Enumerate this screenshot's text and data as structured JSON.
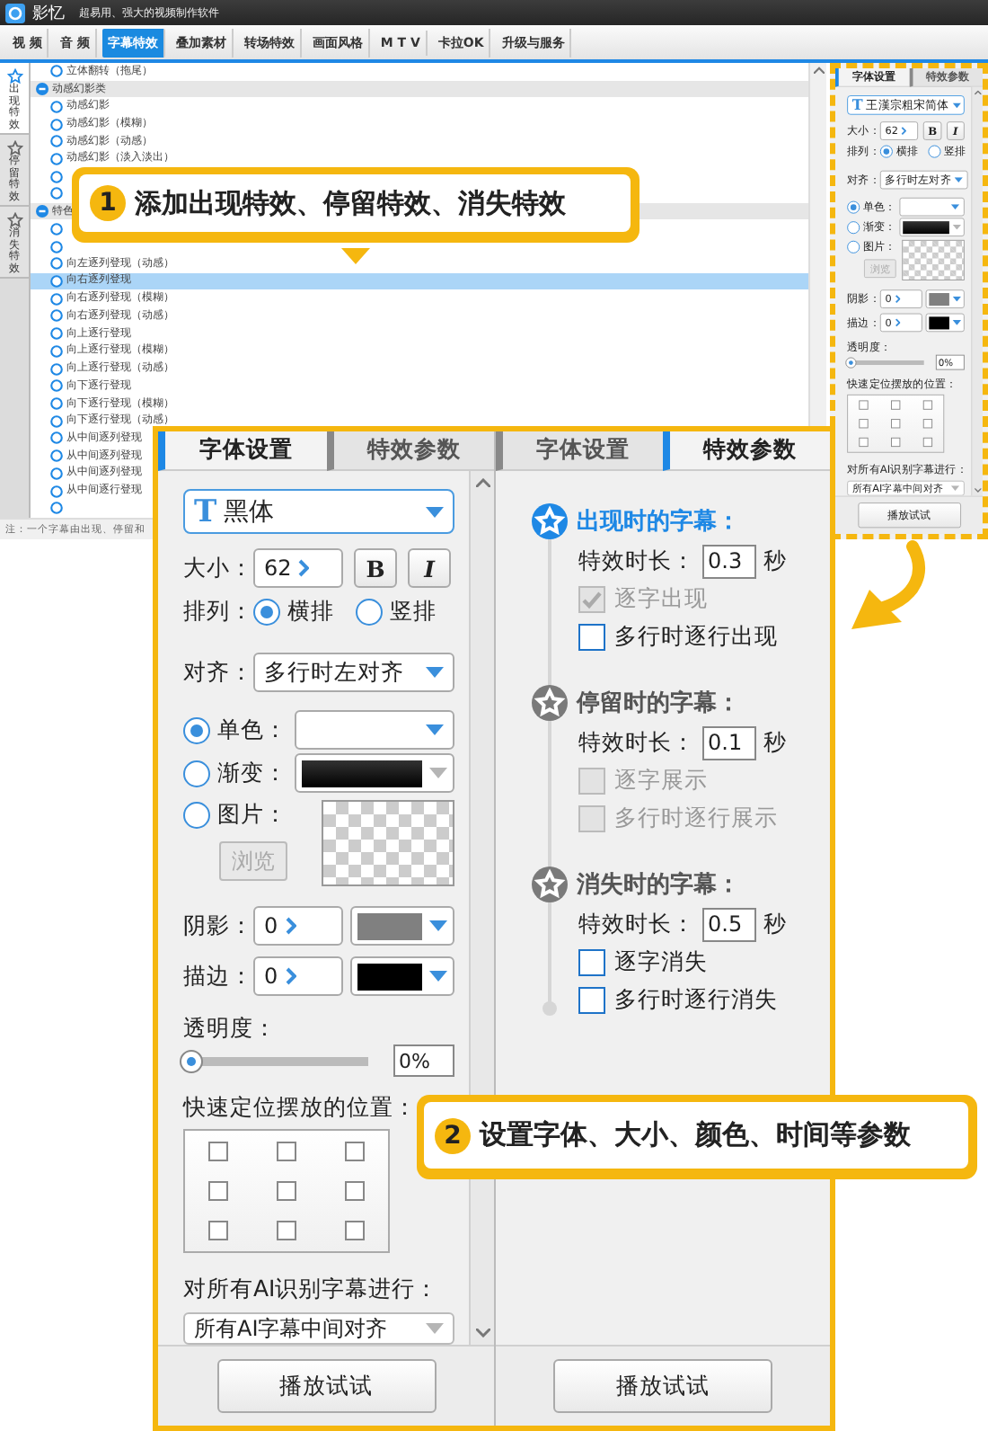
{
  "app": {
    "name": "影忆",
    "tagline": "超易用、强大的视频制作软件"
  },
  "menu": [
    {
      "label": "视 频",
      "selected": false
    },
    {
      "label": "音 频",
      "selected": false
    },
    {
      "label": "字幕特效",
      "selected": true
    },
    {
      "label": "叠加素材",
      "selected": false
    },
    {
      "label": "转场特效",
      "selected": false
    },
    {
      "label": "画面风格",
      "selected": false
    },
    {
      "label": "M T V",
      "selected": false
    },
    {
      "label": "卡拉OK",
      "selected": false
    },
    {
      "label": "升级与服务",
      "selected": false
    }
  ],
  "side_tabs": [
    {
      "label": "出现特效",
      "selected": true
    },
    {
      "label": "停留特效",
      "selected": false
    },
    {
      "label": "消失特效",
      "selected": false
    }
  ],
  "effects_list": [
    {
      "kind": "item",
      "label": "立体翻转（拖尾）",
      "selected": false
    },
    {
      "kind": "group",
      "label": "动感幻影类",
      "expanded": true
    },
    {
      "kind": "item",
      "label": "动感幻影",
      "selected": false
    },
    {
      "kind": "item",
      "label": "动感幻影（模糊）",
      "selected": false
    },
    {
      "kind": "item",
      "label": "动感幻影（动感）",
      "selected": false
    },
    {
      "kind": "item",
      "label": "动感幻影（淡入淡出）",
      "selected": false
    },
    {
      "kind": "item",
      "selected": false
    },
    {
      "kind": "item",
      "selected": false
    },
    {
      "kind": "group",
      "label": "特色",
      "expanded": true
    },
    {
      "kind": "item",
      "selected": false
    },
    {
      "kind": "item",
      "selected": false
    },
    {
      "kind": "item",
      "label": "向左逐列登现（动感）",
      "selected": false
    },
    {
      "kind": "item",
      "label": "向右逐列登现",
      "selected": true
    },
    {
      "kind": "item",
      "label": "向右逐列登现（模糊）",
      "selected": false
    },
    {
      "kind": "item",
      "label": "向右逐列登现（动感）",
      "selected": false
    },
    {
      "kind": "item",
      "label": "向上逐行登现",
      "selected": false
    },
    {
      "kind": "item",
      "label": "向上逐行登现（模糊）",
      "selected": false
    },
    {
      "kind": "item",
      "label": "向上逐行登现（动感）",
      "selected": false
    },
    {
      "kind": "item",
      "label": "向下逐行登现",
      "selected": false
    },
    {
      "kind": "item",
      "label": "向下逐行登现（模糊）",
      "selected": false
    },
    {
      "kind": "item",
      "label": "向下逐行登现（动感）",
      "selected": false
    },
    {
      "kind": "item",
      "label": "从中间逐列登现",
      "selected": false
    },
    {
      "kind": "item",
      "label": "从中间逐列登现",
      "selected": false
    },
    {
      "kind": "item",
      "label": "从中间逐列登现",
      "selected": false
    },
    {
      "kind": "item",
      "label": "从中间逐行登现",
      "selected": false
    },
    {
      "kind": "item",
      "selected": false
    }
  ],
  "note": "注：一个字幕由出现、停留和",
  "mini_panel": {
    "tabs": [
      {
        "label": "字体设置",
        "selected": true
      },
      {
        "label": "特效参数",
        "selected": false
      }
    ],
    "font_icon": "T",
    "font": "王漢宗粗宋简体",
    "size_label": "大小：",
    "size": "62",
    "bold_button": "B",
    "italic_button": "I",
    "layout_label": "排列：",
    "layout": [
      {
        "label": "横排",
        "selected": true
      },
      {
        "label": "竖排",
        "selected": false
      }
    ],
    "align_label": "对齐：",
    "align": "多行时左对齐",
    "fill": [
      {
        "kind": "solid",
        "label": "单色：",
        "selected": true
      },
      {
        "kind": "gradient",
        "label": "渐变：",
        "selected": false
      },
      {
        "kind": "image",
        "label": "图片：",
        "selected": false
      }
    ],
    "browse_button": {
      "label": "浏览",
      "disabled": true
    },
    "outline": [
      {
        "label": "阴影：",
        "value": "0",
        "color": "#808080"
      },
      {
        "label": "描边：",
        "value": "0",
        "color": "#000000"
      }
    ],
    "opacity_label": "透明度：",
    "opacity": {
      "level": 0,
      "reading": "0%"
    },
    "position_label": "快速定位摆放的位置：",
    "positions": [
      {
        "checked": false
      },
      {
        "checked": false
      },
      {
        "checked": false
      },
      {
        "checked": false
      },
      {
        "checked": false
      },
      {
        "checked": false
      },
      {
        "checked": false
      },
      {
        "checked": false
      },
      {
        "checked": false
      }
    ],
    "ai_label": "对所有AI识别字幕进行：",
    "ai_option": "所有AI字幕中间对齐",
    "play_button": "播放试试"
  },
  "callout_1": {
    "number": "1",
    "text": "添加出现特效、停留特效、消失特效"
  },
  "zoom_panel": {
    "font_settings": {
      "tabs": [
        {
          "label": "字体设置",
          "selected": true
        },
        {
          "label": "特效参数",
          "selected": false
        }
      ],
      "font_icon": "T",
      "font": "黑体",
      "size_label": "大小：",
      "size": "62",
      "bold_button": "B",
      "italic_button": "I",
      "layout_label": "排列：",
      "layout": [
        {
          "label": "横排",
          "selected": true
        },
        {
          "label": "竖排",
          "selected": false
        }
      ],
      "align_label": "对齐：",
      "align": "多行时左对齐",
      "fill": [
        {
          "kind": "solid",
          "label": "单色：",
          "selected": true
        },
        {
          "kind": "gradient",
          "label": "渐变：",
          "selected": false
        },
        {
          "kind": "image",
          "label": "图片：",
          "selected": false
        }
      ],
      "browse_button": {
        "label": "浏览",
        "disabled": true
      },
      "outline": [
        {
          "label": "阴影：",
          "value": "0",
          "color": "#808080"
        },
        {
          "label": "描边：",
          "value": "0",
          "color": "#000000"
        }
      ],
      "opacity_label": "透明度：",
      "opacity": {
        "level": 0,
        "reading": "0%"
      },
      "position_label": "快速定位摆放的位置：",
      "positions": [
        {
          "checked": false
        },
        {
          "checked": false
        },
        {
          "checked": false
        },
        {
          "checked": false
        },
        {
          "checked": false
        },
        {
          "checked": false
        },
        {
          "checked": false
        },
        {
          "checked": false
        },
        {
          "checked": false
        }
      ],
      "ai_label": "对所有AI识别字幕进行：",
      "ai_option": "所有AI字幕中间对齐",
      "play_button": "播放试试"
    },
    "effect_tabs": [
      {
        "label": "字体设置",
        "selected": false
      },
      {
        "label": "特效参数",
        "selected": true
      }
    ],
    "sections": [
      {
        "title": "出现时的字幕：",
        "active": true,
        "duration_label": "特效时长：",
        "duration": "0.3",
        "unit": "秒",
        "options": [
          {
            "label": "逐字出现",
            "checked": true,
            "disabled": true
          },
          {
            "label": "多行时逐行出现",
            "checked": false,
            "disabled": false
          }
        ]
      },
      {
        "title": "停留时的字幕：",
        "active": false,
        "duration_label": "特效时长：",
        "duration": "0.1",
        "unit": "秒",
        "options": [
          {
            "label": "逐字展示",
            "checked": false,
            "disabled": true
          },
          {
            "label": "多行时逐行展示",
            "checked": false,
            "disabled": true
          }
        ]
      },
      {
        "title": "消失时的字幕：",
        "active": false,
        "duration_label": "特效时长：",
        "duration": "0.5",
        "unit": "秒",
        "options": [
          {
            "label": "逐字消失",
            "checked": false,
            "disabled": false
          },
          {
            "label": "多行时逐行消失",
            "checked": false,
            "disabled": false
          }
        ]
      }
    ],
    "play_button": "播放试试"
  },
  "callout_2": {
    "number": "2",
    "text": "设置字体、大小、颜色、时间等参数"
  }
}
